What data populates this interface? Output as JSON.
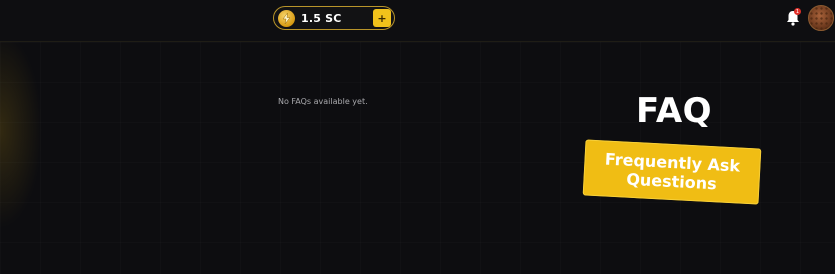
{
  "header": {
    "balance": "1.5 SC",
    "add_label": "+",
    "notification_count": "1"
  },
  "main": {
    "empty_message": "No FAQs available yet."
  },
  "banner": {
    "title": "FAQ",
    "subtitle": "Frequently Ask Questions"
  },
  "colors": {
    "accent": "#f0bd14",
    "background": "#0d0d10",
    "badge": "#e0302a"
  },
  "icons": {
    "coin": "lightning-coin-icon",
    "notifications": "bell-icon",
    "profile": "avatar"
  }
}
